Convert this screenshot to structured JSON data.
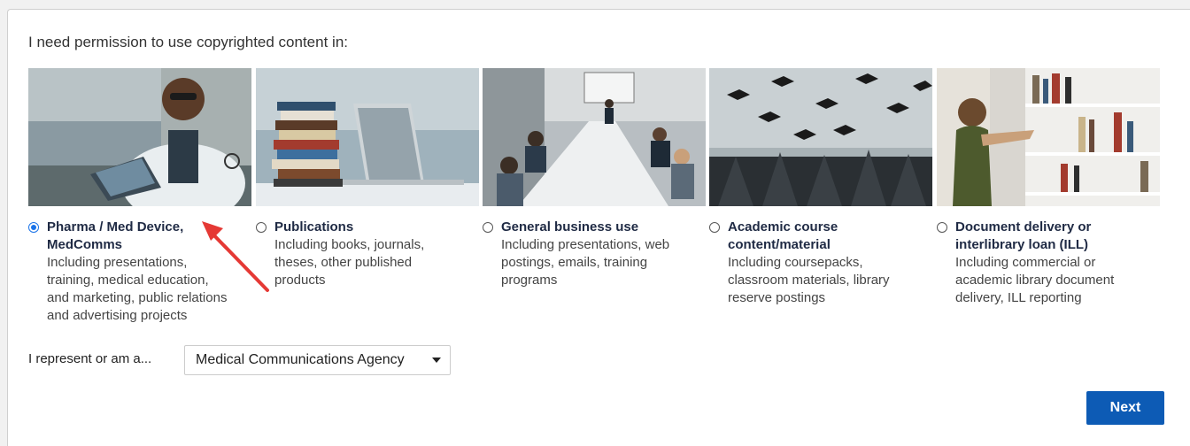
{
  "prompt": "I need permission to use copyrighted content in:",
  "options": [
    {
      "title_lines": [
        "Pharma / Med Device,",
        "MedComms"
      ],
      "desc_lines": [
        "Including presentations,",
        "training, medical education,",
        "and marketing, public relations",
        "and advertising projects"
      ],
      "selected": true,
      "image": "doctor-with-tablet-photo"
    },
    {
      "title_lines": [
        "Publications"
      ],
      "desc_lines": [
        "Including books, journals,",
        "theses, other published",
        "products"
      ],
      "selected": false,
      "image": "books-and-laptop-photo"
    },
    {
      "title_lines": [
        "General business use"
      ],
      "desc_lines": [
        "Including presentations, web",
        "postings, emails, training",
        "programs"
      ],
      "selected": false,
      "image": "business-meeting-photo"
    },
    {
      "title_lines": [
        "Academic course",
        "content/material"
      ],
      "desc_lines": [
        "Including coursepacks,",
        "classroom materials, library",
        "reserve postings"
      ],
      "selected": false,
      "image": "graduation-caps-photo"
    },
    {
      "title_lines": [
        "Document delivery or",
        "interlibrary loan (ILL)"
      ],
      "desc_lines": [
        "Including commercial or",
        "academic library document",
        "delivery, ILL reporting"
      ],
      "selected": false,
      "image": "library-shelves-photo"
    }
  ],
  "represent": {
    "label": "I represent or am a...",
    "value": "Medical Communications Agency"
  },
  "next_label": "Next",
  "colors": {
    "accent": "#1a73e8",
    "button": "#0d5bb5",
    "arrow": "#e53935"
  }
}
